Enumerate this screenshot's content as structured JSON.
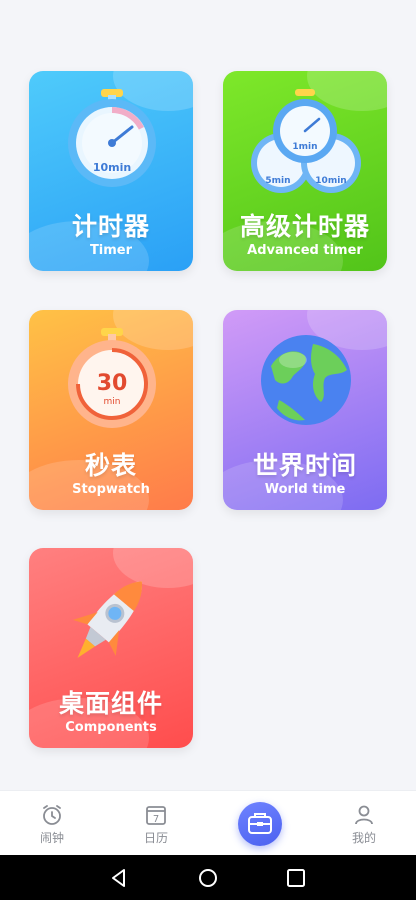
{
  "cards": [
    {
      "title": "计时器",
      "subtitle": "Timer",
      "art_label": "10min",
      "color": "#2aa0f6"
    },
    {
      "title": "高级计时器",
      "subtitle": "Advanced  timer",
      "art_labels": [
        "1min",
        "5min",
        "10min"
      ],
      "color": "#52c41a"
    },
    {
      "title": "秒表",
      "subtitle": "Stopwatch",
      "art_value": "30",
      "art_unit": "min",
      "color": "#ff7b4a"
    },
    {
      "title": "世界时间",
      "subtitle": "World time",
      "color": "#7d6cf2"
    },
    {
      "title": "桌面组件",
      "subtitle": "Components",
      "color": "#ff4d4d"
    }
  ],
  "tabbar": {
    "tabs": [
      {
        "label": "闹钟",
        "icon": "alarm-clock-icon"
      },
      {
        "label": "日历",
        "icon": "calendar-icon",
        "badge": "7"
      },
      {
        "label": "",
        "icon": "toolbox-icon",
        "active": true
      },
      {
        "label": "我的",
        "icon": "person-icon"
      }
    ]
  },
  "system_nav": {
    "buttons": [
      "back-icon",
      "home-icon",
      "recents-icon"
    ]
  }
}
